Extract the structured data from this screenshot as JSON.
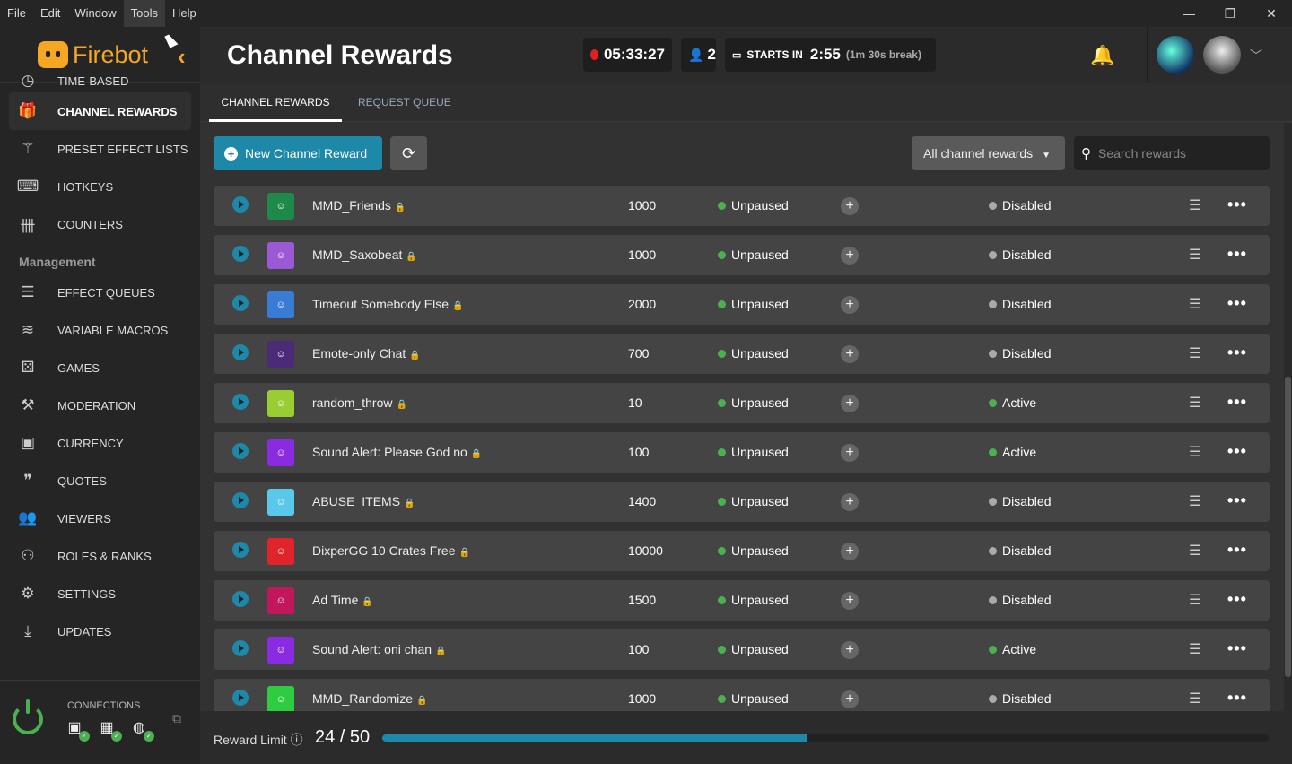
{
  "menubar": {
    "items": [
      "File",
      "Edit",
      "Window",
      "Tools",
      "Help"
    ],
    "active": "Tools"
  },
  "window_controls": {
    "minimize": "—",
    "maximize": "❐",
    "close": "✕"
  },
  "app": {
    "name": "Firebot",
    "brand_color": "#f5a623",
    "accent": "#1e88a8"
  },
  "sidebar": {
    "items_top": [
      {
        "label": "TIME-BASED",
        "icon": "clock-icon"
      },
      {
        "label": "CHANNEL REWARDS",
        "icon": "gift-icon",
        "active": true
      },
      {
        "label": "PRESET EFFECT LISTS",
        "icon": "magic-wand-icon"
      },
      {
        "label": "HOTKEYS",
        "icon": "keyboard-icon"
      },
      {
        "label": "COUNTERS",
        "icon": "tally-icon"
      }
    ],
    "section_label": "Management",
    "items_mgmt": [
      {
        "label": "EFFECT QUEUES",
        "icon": "list-icon"
      },
      {
        "label": "VARIABLE MACROS",
        "icon": "layers-icon"
      },
      {
        "label": "GAMES",
        "icon": "dice-icon"
      },
      {
        "label": "MODERATION",
        "icon": "gavel-icon"
      },
      {
        "label": "CURRENCY",
        "icon": "money-icon"
      },
      {
        "label": "QUOTES",
        "icon": "quote-icon"
      },
      {
        "label": "VIEWERS",
        "icon": "users-icon"
      },
      {
        "label": "ROLES & RANKS",
        "icon": "user-tag-icon"
      },
      {
        "label": "SETTINGS",
        "icon": "gear-icon"
      },
      {
        "label": "UPDATES",
        "icon": "download-icon"
      }
    ],
    "connections_label": "CONNECTIONS"
  },
  "header": {
    "title": "Channel Rewards",
    "uptime": "05:33:27",
    "viewers": "2",
    "ad_label": "STARTS IN",
    "ad_time": "2:55",
    "ad_break": "(1m 30s break)"
  },
  "tabs": [
    "CHANNEL REWARDS",
    "REQUEST QUEUE"
  ],
  "toolbar": {
    "new_label": "New Channel Reward",
    "filter_label": "All channel rewards",
    "search_placeholder": "Search rewards"
  },
  "rewards": [
    {
      "name": "MMD_Friends",
      "cost": "1000",
      "pause": "Unpaused",
      "state": "Disabled",
      "thumb": "#1e8a4a"
    },
    {
      "name": "MMD_Saxobeat",
      "cost": "1000",
      "pause": "Unpaused",
      "state": "Disabled",
      "thumb": "#9b59d6"
    },
    {
      "name": "Timeout Somebody Else",
      "cost": "2000",
      "pause": "Unpaused",
      "state": "Disabled",
      "thumb": "#3a7bd5"
    },
    {
      "name": "Emote-only Chat",
      "cost": "700",
      "pause": "Unpaused",
      "state": "Disabled",
      "thumb": "#4b2a78"
    },
    {
      "name": "random_throw",
      "cost": "10",
      "pause": "Unpaused",
      "state": "Active",
      "thumb": "#9acd32"
    },
    {
      "name": "Sound Alert: Please God no",
      "cost": "100",
      "pause": "Unpaused",
      "state": "Active",
      "thumb": "#8a2be2"
    },
    {
      "name": "ABUSE_ITEMS",
      "cost": "1400",
      "pause": "Unpaused",
      "state": "Disabled",
      "thumb": "#5ac8e8"
    },
    {
      "name": "DixperGG 10 Crates Free",
      "cost": "10000",
      "pause": "Unpaused",
      "state": "Disabled",
      "thumb": "#e0242c"
    },
    {
      "name": "Ad Time",
      "cost": "1500",
      "pause": "Unpaused",
      "state": "Disabled",
      "thumb": "#c2185b"
    },
    {
      "name": "Sound Alert: oni chan",
      "cost": "100",
      "pause": "Unpaused",
      "state": "Active",
      "thumb": "#8a2be2"
    },
    {
      "name": "MMD_Randomize",
      "cost": "1000",
      "pause": "Unpaused",
      "state": "Disabled",
      "thumb": "#2ecc40"
    }
  ],
  "status_colors": {
    "Unpaused": "#4caf50",
    "Active": "#4caf50",
    "Disabled": "#aaaaaa"
  },
  "footer": {
    "label": "Reward Limit",
    "count": "24 / 50",
    "used": 24,
    "max": 50
  }
}
